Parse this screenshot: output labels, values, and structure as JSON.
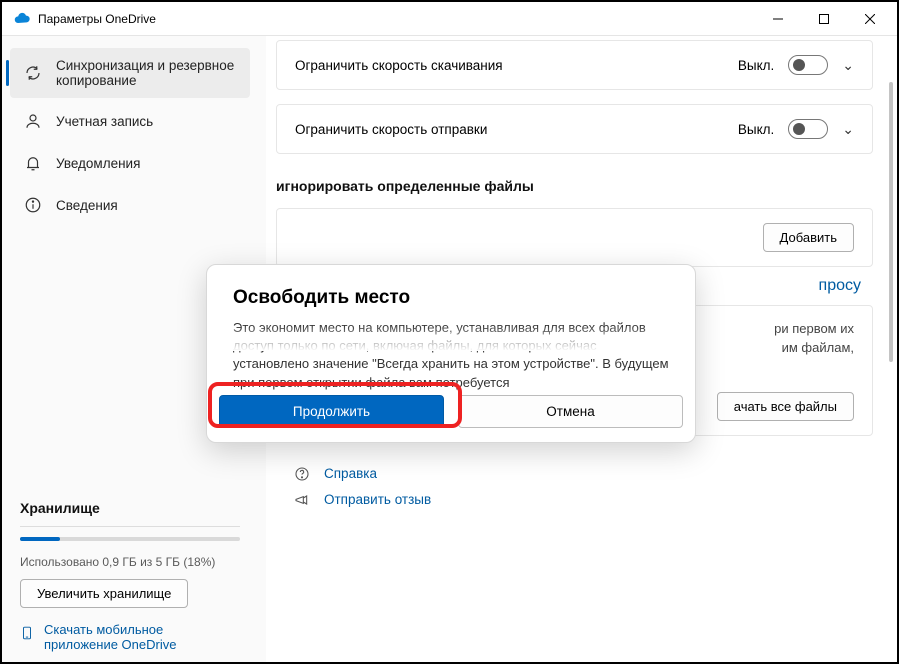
{
  "window": {
    "title": "Параметры OneDrive"
  },
  "sidebar": {
    "items": [
      {
        "label": "Синхронизация и резервное копирование"
      },
      {
        "label": "Учетная запись"
      },
      {
        "label": "Уведомления"
      },
      {
        "label": "Сведения"
      }
    ]
  },
  "storage": {
    "title": "Хранилище",
    "used_text": "Использовано 0,9 ГБ из 5 ГБ (18%)",
    "percent": 18,
    "increase_label": "Увеличить хранилище",
    "mobile_link": "Скачать мобильное приложение OneDrive"
  },
  "settings": {
    "download_limit": {
      "label": "Ограничить скорость скачивания",
      "state": "Выкл."
    },
    "upload_limit": {
      "label": "Ограничить скорость отправки",
      "state": "Выкл."
    },
    "ignore_title": "игнорировать определенные файлы",
    "add_button": "Добавить",
    "on_demand_link": "просу",
    "on_demand_note_1": "ри первом их",
    "on_demand_note_2": "им файлам,",
    "download_all": "ачать все файлы",
    "help": "Справка",
    "feedback": "Отправить отзыв"
  },
  "dialog": {
    "title": "Освободить место",
    "text": "Это экономит место на компьютере, устанавливая для всех файлов доступ только по сети, включая файлы, для которых сейчас установлено значение \"Всегда хранить на этом устройстве\". В будущем при первом открытии файла вам потребуется",
    "continue": "Продолжить",
    "cancel": "Отмена"
  }
}
